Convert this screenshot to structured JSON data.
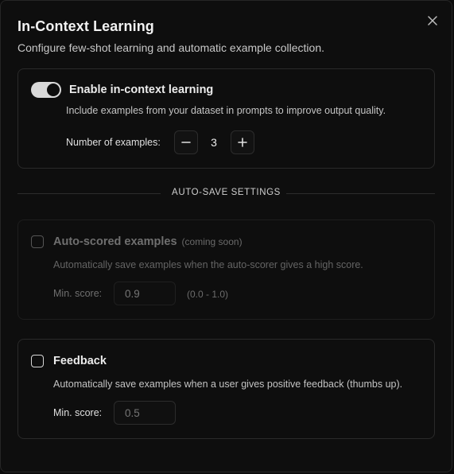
{
  "dialog": {
    "title": "In-Context Learning",
    "subtitle": "Configure few-shot learning and automatic example collection.",
    "close_icon": "close-icon"
  },
  "icl": {
    "enabled": true,
    "label": "Enable in-context learning",
    "description": "Include examples from your dataset in prompts to improve output quality.",
    "examples_label": "Number of examples:",
    "examples_value": "3",
    "decrement_icon": "minus-icon",
    "increment_icon": "plus-icon"
  },
  "autosave": {
    "heading": "AUTO-SAVE SETTINGS",
    "auto_scored": {
      "checked": false,
      "disabled": true,
      "label": "Auto-scored examples",
      "tag": "(coming soon)",
      "description": "Automatically save examples when the auto-scorer gives a high score.",
      "min_score_label": "Min. score:",
      "min_score_placeholder": "0.9",
      "range_note": "(0.0 - 1.0)"
    },
    "feedback": {
      "checked": false,
      "label": "Feedback",
      "description": "Automatically save examples when a user gives positive feedback (thumbs up).",
      "min_score_label": "Min. score:",
      "min_score_placeholder": "0.5"
    }
  },
  "colors": {
    "background": "#0e0e0e",
    "border": "#2a2a2a",
    "toggle_on": "#d9d9d9",
    "text": "#ececec",
    "muted": "#6f6f6f"
  }
}
